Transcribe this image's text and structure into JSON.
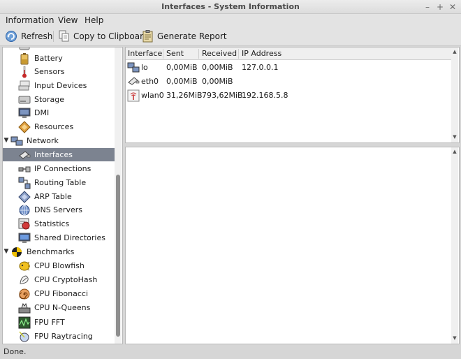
{
  "window": {
    "title": "Interfaces - System Information"
  },
  "menubar": {
    "items": [
      "Information",
      "View",
      "Help"
    ]
  },
  "toolbar": {
    "refresh": "Refresh",
    "copy": "Copy to Clipboard",
    "report": "Generate Report"
  },
  "sidebar": {
    "items": [
      {
        "label": "",
        "icon": "drive-icon"
      },
      {
        "label": "Battery",
        "icon": "battery-icon"
      },
      {
        "label": "Sensors",
        "icon": "thermometer-icon"
      },
      {
        "label": "Input Devices",
        "icon": "keyboard-icon"
      },
      {
        "label": "Storage",
        "icon": "harddisk-icon"
      },
      {
        "label": "DMI",
        "icon": "monitor-icon"
      },
      {
        "label": "Resources",
        "icon": "resources-icon"
      },
      {
        "label": "Network",
        "icon": "network-icon",
        "group": true
      },
      {
        "label": "Interfaces",
        "icon": "interface-icon",
        "selected": true
      },
      {
        "label": "IP Connections",
        "icon": "connection-icon"
      },
      {
        "label": "Routing Table",
        "icon": "routing-icon"
      },
      {
        "label": "ARP Table",
        "icon": "arp-icon"
      },
      {
        "label": "DNS Servers",
        "icon": "dns-icon"
      },
      {
        "label": "Statistics",
        "icon": "statistics-icon"
      },
      {
        "label": "Shared Directories",
        "icon": "shared-folder-icon"
      },
      {
        "label": "Benchmarks",
        "icon": "benchmark-icon",
        "group": true
      },
      {
        "label": "CPU Blowfish",
        "icon": "blowfish-icon"
      },
      {
        "label": "CPU CryptoHash",
        "icon": "cryptohash-icon"
      },
      {
        "label": "CPU Fibonacci",
        "icon": "fibonacci-icon"
      },
      {
        "label": "CPU N-Queens",
        "icon": "nqueens-icon"
      },
      {
        "label": "FPU FFT",
        "icon": "fft-icon"
      },
      {
        "label": "FPU Raytracing",
        "icon": "raytracing-icon"
      }
    ]
  },
  "table": {
    "headers": [
      "Interface",
      "Sent",
      "Received",
      "IP Address"
    ],
    "rows": [
      {
        "interface": "lo",
        "sent": "0,00MiB",
        "received": "0,00MiB",
        "ip": "127.0.0.1",
        "icon": "loopback-icon"
      },
      {
        "interface": "eth0",
        "sent": "0,00MiB",
        "received": "0,00MiB",
        "ip": "",
        "icon": "ethernet-icon"
      },
      {
        "interface": "wlan0",
        "sent": "31,26MiB",
        "received": "793,62MiB",
        "ip": "192.168.5.8",
        "icon": "wireless-icon"
      }
    ]
  },
  "status": {
    "text": "Done."
  }
}
